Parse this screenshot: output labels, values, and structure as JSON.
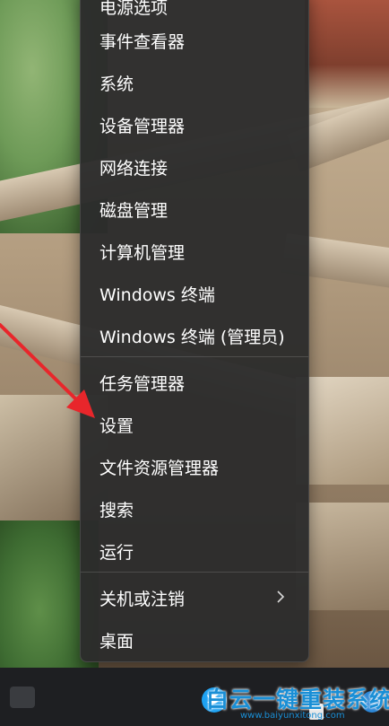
{
  "menu": {
    "items": [
      {
        "label": "电源选项"
      },
      {
        "label": "事件查看器"
      },
      {
        "label": "系统"
      },
      {
        "label": "设备管理器"
      },
      {
        "label": "网络连接"
      },
      {
        "label": "磁盘管理"
      },
      {
        "label": "计算机管理"
      },
      {
        "label": "Windows 终端"
      },
      {
        "label": "Windows 终端 (管理员)"
      },
      {
        "label": "任务管理器"
      },
      {
        "label": "设置"
      },
      {
        "label": "文件资源管理器"
      },
      {
        "label": "搜索"
      },
      {
        "label": "运行"
      },
      {
        "label": "关机或注销"
      },
      {
        "label": "桌面"
      }
    ]
  },
  "watermark": {
    "title": "白云一键重装系统",
    "url": "www.baiyunxitong.com"
  },
  "colors": {
    "menu_bg": "#2c2c2c",
    "menu_text": "#ffffff",
    "arrow": "#e8262b",
    "watermark": "#1a8fd6"
  }
}
